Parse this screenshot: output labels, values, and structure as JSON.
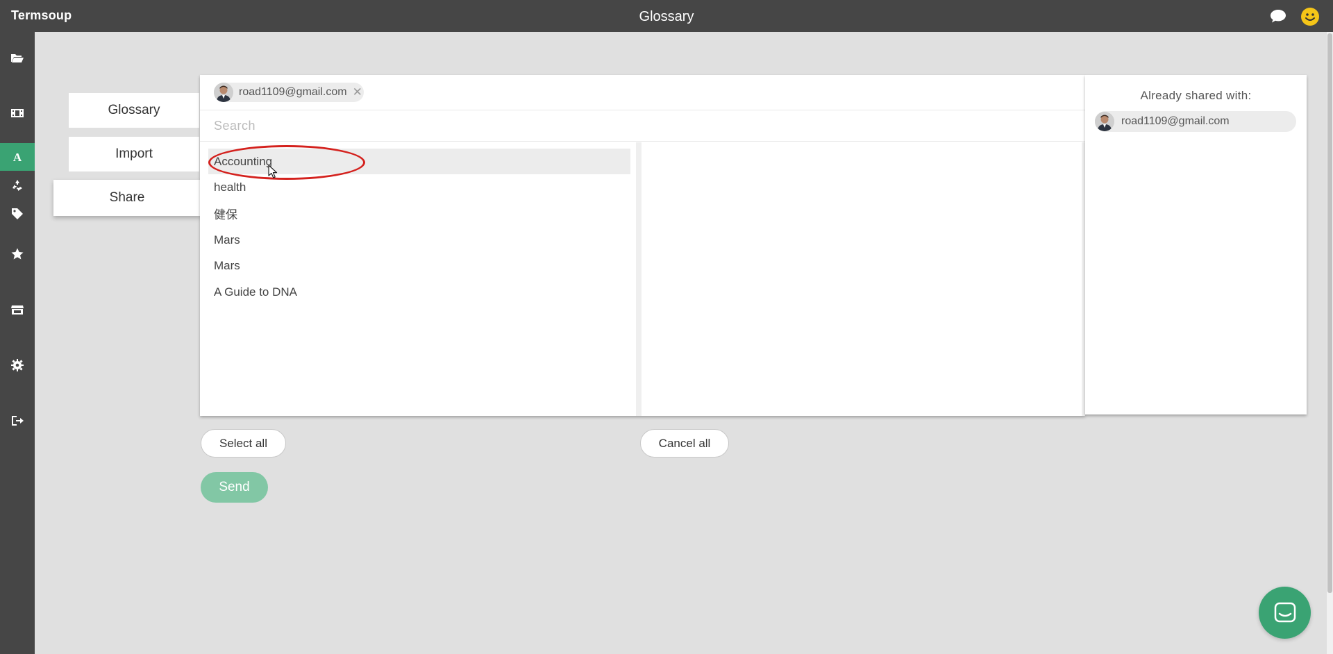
{
  "app": {
    "brand": "Termsoup",
    "title": "Glossary"
  },
  "header_icons": [
    "chat-bubble-icon",
    "smiley-icon"
  ],
  "sidebar": {
    "items": [
      {
        "icon": "folder-open-icon",
        "active": false
      },
      {
        "icon": "film-icon",
        "active": false
      },
      {
        "icon": "glossary-a-icon",
        "active": true
      },
      {
        "icon": "recycle-icon",
        "active": false
      },
      {
        "icon": "tag-icon",
        "active": false
      },
      {
        "icon": "star-icon",
        "active": false
      },
      {
        "icon": "store-icon",
        "active": false
      },
      {
        "icon": "gear-icon",
        "active": false
      },
      {
        "icon": "sign-out-icon",
        "active": false
      }
    ]
  },
  "left_tabs": [
    {
      "label": "Glossary",
      "active": false
    },
    {
      "label": "Import",
      "active": false
    },
    {
      "label": "Share",
      "active": true
    }
  ],
  "share": {
    "recipient_chip": {
      "email": "road1109@gmail.com",
      "remove_glyph": "✕"
    },
    "search": {
      "placeholder": "Search",
      "value": ""
    },
    "glossary_list": [
      {
        "label": "Accounting",
        "highlighted": true
      },
      {
        "label": "health",
        "highlighted": false
      },
      {
        "label": "健保",
        "highlighted": false
      },
      {
        "label": "Mars",
        "highlighted": false
      },
      {
        "label": "Mars",
        "highlighted": false
      },
      {
        "label": "A Guide to DNA",
        "highlighted": false
      }
    ],
    "selected_list": [],
    "already_shared": {
      "title": "Already shared with:",
      "users": [
        {
          "email": "road1109@gmail.com"
        }
      ]
    },
    "buttons": {
      "select_all": "Select all",
      "cancel_all": "Cancel all",
      "send": "Send"
    }
  },
  "colors": {
    "accent": "#3aa373",
    "send_disabled": "#82c7a5",
    "topbar": "#464646",
    "background": "#e0e0e0",
    "annotation": "#d4211d"
  }
}
